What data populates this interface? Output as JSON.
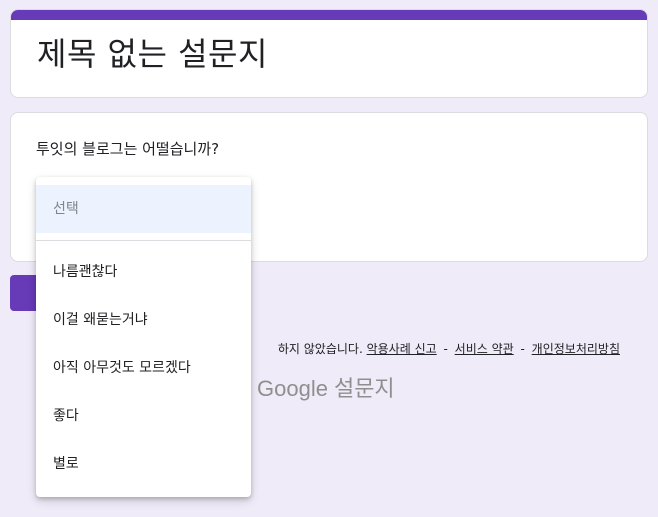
{
  "form": {
    "title": "제목 없는 설문지",
    "accent_color": "#673ab7",
    "background_color": "#f0ebf8"
  },
  "question": {
    "text": "투잇의 블로그는 어떨습니까?",
    "dropdown": {
      "placeholder": "선택",
      "options": [
        "나름괜찮다",
        "이걸 왜묻는거냐",
        "아직 아무것도 모르겠다",
        "좋다",
        "별로"
      ]
    }
  },
  "footer": {
    "notice_fragment": "하지 않았습니다.",
    "links": [
      "악용사례 신고",
      "서비스 약관",
      "개인정보처리방침"
    ],
    "separator": "-"
  },
  "brand": {
    "google": "Google",
    "product": "설문지"
  }
}
